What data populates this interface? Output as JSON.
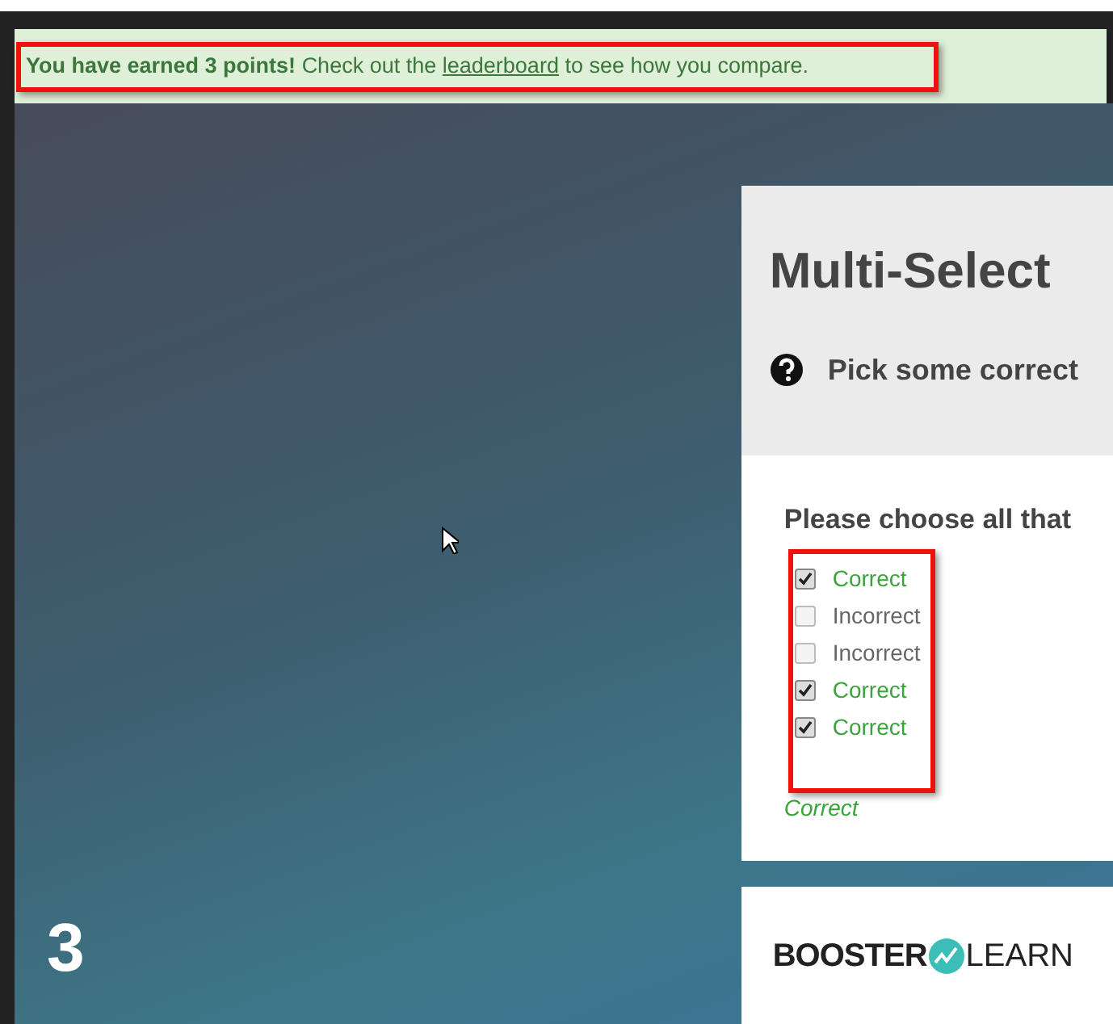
{
  "notice": {
    "bold": "You have earned 3 points!",
    "lead": "Check out the",
    "link": "leaderboard",
    "tail": "to see how you compare."
  },
  "quiz": {
    "title": "Multi-Select",
    "prompt": "Pick some correct",
    "question": "Please choose all that",
    "options": [
      {
        "label": "Correct",
        "kind": "correct",
        "checked": true
      },
      {
        "label": "Incorrect",
        "kind": "incorrect",
        "checked": false
      },
      {
        "label": "Incorrect",
        "kind": "incorrect",
        "checked": false
      },
      {
        "label": "Correct",
        "kind": "correct",
        "checked": true
      },
      {
        "label": "Correct",
        "kind": "correct",
        "checked": true
      }
    ],
    "feedback": "Correct"
  },
  "logo": {
    "first": "BOOSTER",
    "second": "LEARN"
  },
  "step": "3"
}
